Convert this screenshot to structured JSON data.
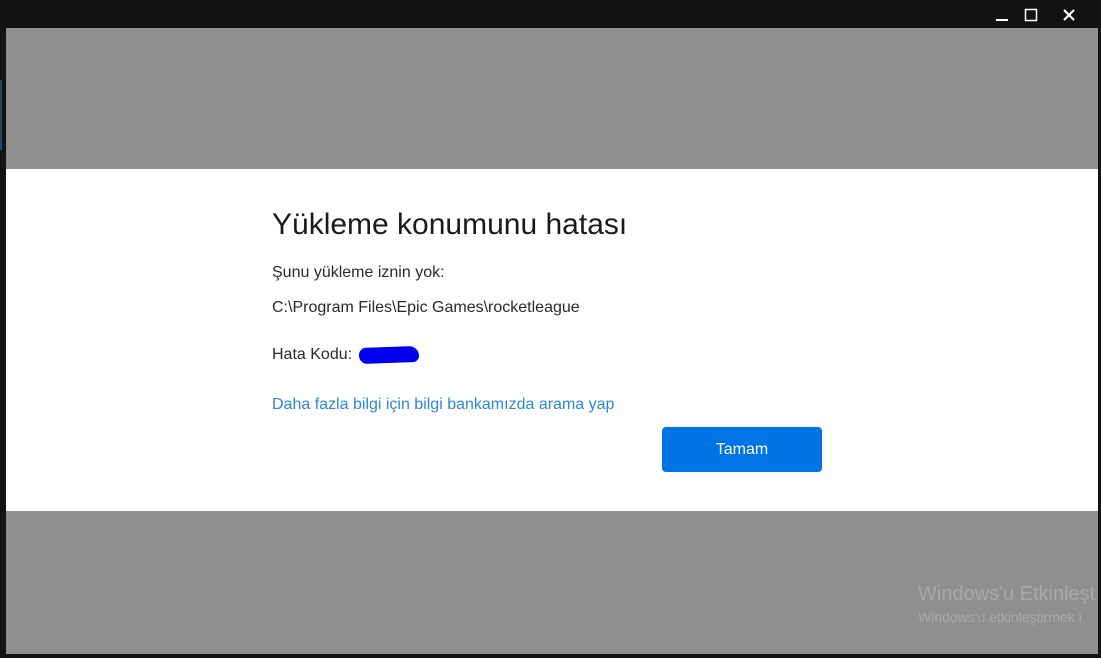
{
  "window": {
    "controls": {
      "minimize_icon": "minimize-icon",
      "maximize_icon": "maximize-icon",
      "close_icon": "close-icon"
    }
  },
  "dialog": {
    "title": "Yükleme konumunu hatası",
    "subtitle": "Şunu yükleme iznin yok:",
    "path": "C:\\Program Files\\Epic Games\\rocketleague",
    "error_code_label": "Hata Kodu:",
    "error_code_value": "[redacted]",
    "kb_link": "Daha fazla bilgi için bilgi bankamızda arama yap",
    "ok_button": "Tamam"
  },
  "watermark": {
    "title": "Windows'u Etkinleşt",
    "subtitle": "Windows'u etkinleştirmek i"
  },
  "colors": {
    "overlay": "#8f8f8f",
    "dialog_bg": "#ffffff",
    "accent": "#0074e4",
    "link": "#2f86d8",
    "titlebar": "#131313"
  }
}
